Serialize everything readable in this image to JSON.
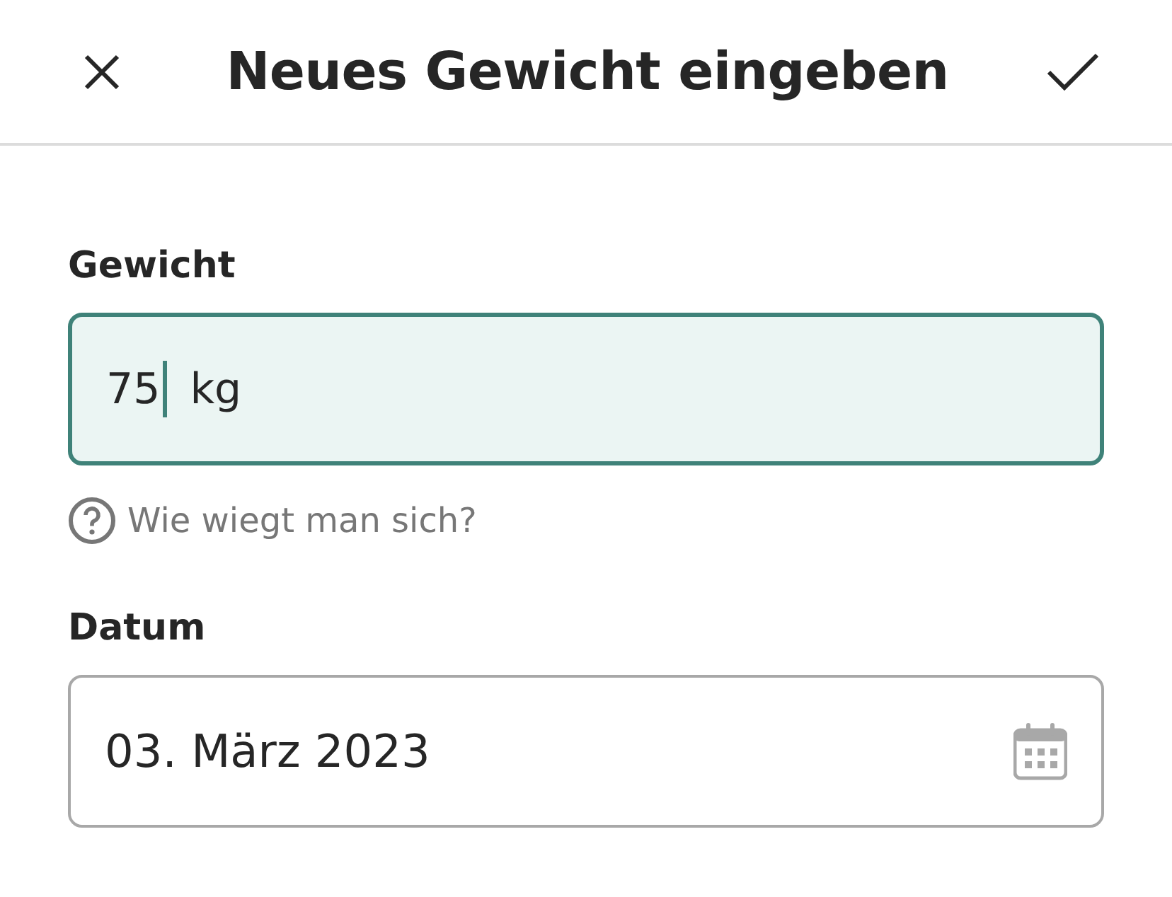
{
  "header": {
    "title": "Neues Gewicht eingeben"
  },
  "weight": {
    "label": "Gewicht",
    "value": "75",
    "unit": "kg",
    "focused": true
  },
  "help_link": {
    "text": "Wie wiegt man sich?"
  },
  "date": {
    "label": "Datum",
    "value": "03. März 2023",
    "focused": false
  }
}
